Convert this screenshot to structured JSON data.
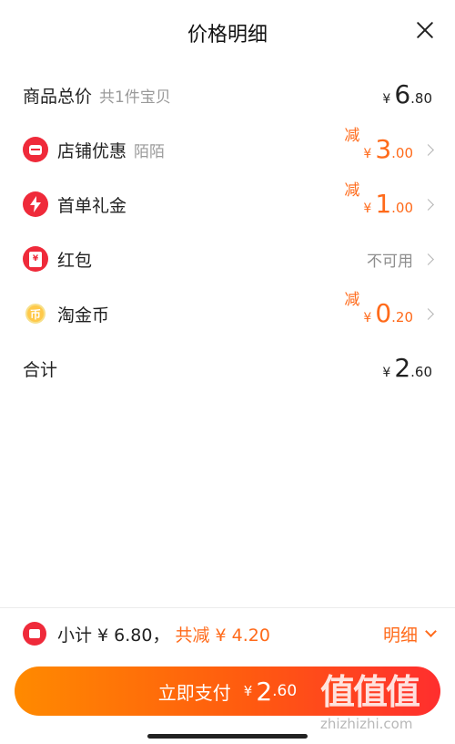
{
  "header": {
    "title": "价格明细"
  },
  "rows": {
    "total": {
      "label": "商品总价",
      "sub": "共1件宝贝",
      "yen": "¥",
      "int": "6",
      "dec": ".80"
    },
    "store": {
      "label": "店铺优惠",
      "sub": "陌陌",
      "minus": "减",
      "yen": "¥",
      "int": "3",
      "dec": ".00",
      "icon": "store-icon"
    },
    "first_order": {
      "label": "首单礼金",
      "minus": "减",
      "yen": "¥",
      "int": "1",
      "dec": ".00",
      "icon": "lightning-icon"
    },
    "red_packet": {
      "label": "红包",
      "status": "不可用",
      "icon": "red-packet-icon",
      "icon_glyph": "¥"
    },
    "taojinbi": {
      "label": "淘金币",
      "minus": "减",
      "yen": "¥",
      "int": "0",
      "dec": ".20",
      "icon": "coin-icon",
      "icon_glyph": "币"
    },
    "sum": {
      "label": "合计",
      "yen": "¥",
      "int": "2",
      "dec": ".60"
    }
  },
  "footer": {
    "subtotal": "小计 ¥ 6.80，",
    "discount": "共减 ¥ 4.20",
    "detail": "明细",
    "pay_label": "立即支付",
    "pay_yen": "¥",
    "pay_int": "2",
    "pay_dec": ".60"
  },
  "watermark": {
    "chars": "值值值",
    "domain": "zhizhizhi.com"
  },
  "colors": {
    "accent": "#ff6a1a",
    "icon_red": "#ef2a3a",
    "pay_gradient_start": "#ff8a00",
    "pay_gradient_end": "#ff2e2e"
  }
}
